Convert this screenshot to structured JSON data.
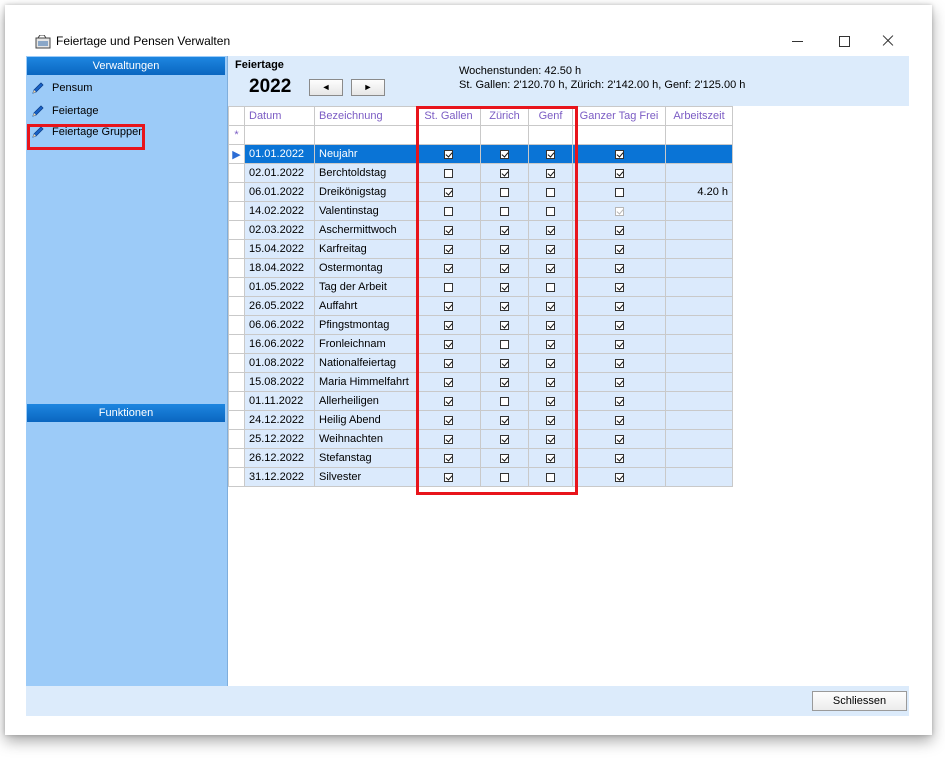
{
  "window": {
    "title": "Feiertage und Pensen Verwalten",
    "close_button": "Schliessen"
  },
  "sidebar": {
    "section1": "Verwaltungen",
    "items": [
      "Pensum",
      "Feiertage",
      "Feiertage Gruppen"
    ],
    "section2": "Funktionen"
  },
  "header": {
    "title": "Feiertage",
    "year": "2022",
    "prev": "◄",
    "next": "►",
    "hours_line": "Wochenstunden: 42.50 h",
    "canton_line": "St. Gallen: 2'120.70 h, Zürich: 2'142.00 h, Genf: 2'125.00 h"
  },
  "grid": {
    "columns": [
      "Datum",
      "Bezeichnung",
      "St. Gallen",
      "Zürich",
      "Genf",
      "Ganzer Tag Frei",
      "Arbeitszeit"
    ],
    "new_row_marker": "*",
    "selected_marker": "▶",
    "rows": [
      {
        "date": "01.01.2022",
        "name": "Neujahr",
        "sg": true,
        "zh": true,
        "ge": true,
        "frei": true,
        "arbeitszeit": ""
      },
      {
        "date": "02.01.2022",
        "name": "Berchtoldstag",
        "sg": false,
        "zh": true,
        "ge": true,
        "frei": true,
        "arbeitszeit": ""
      },
      {
        "date": "06.01.2022",
        "name": "Dreikönigstag",
        "sg": true,
        "zh": false,
        "ge": false,
        "frei": false,
        "arbeitszeit": "4.20 h"
      },
      {
        "date": "14.02.2022",
        "name": "Valentinstag",
        "sg": false,
        "zh": false,
        "ge": false,
        "frei": true,
        "arbeitszeit": "",
        "frei_dim": true
      },
      {
        "date": "02.03.2022",
        "name": "Aschermittwoch",
        "sg": true,
        "zh": true,
        "ge": true,
        "frei": true,
        "arbeitszeit": ""
      },
      {
        "date": "15.04.2022",
        "name": "Karfreitag",
        "sg": true,
        "zh": true,
        "ge": true,
        "frei": true,
        "arbeitszeit": ""
      },
      {
        "date": "18.04.2022",
        "name": "Ostermontag",
        "sg": true,
        "zh": true,
        "ge": true,
        "frei": true,
        "arbeitszeit": ""
      },
      {
        "date": "01.05.2022",
        "name": "Tag der Arbeit",
        "sg": false,
        "zh": true,
        "ge": false,
        "frei": true,
        "arbeitszeit": ""
      },
      {
        "date": "26.05.2022",
        "name": "Auffahrt",
        "sg": true,
        "zh": true,
        "ge": true,
        "frei": true,
        "arbeitszeit": ""
      },
      {
        "date": "06.06.2022",
        "name": "Pfingstmontag",
        "sg": true,
        "zh": true,
        "ge": true,
        "frei": true,
        "arbeitszeit": ""
      },
      {
        "date": "16.06.2022",
        "name": "Fronleichnam",
        "sg": true,
        "zh": false,
        "ge": true,
        "frei": true,
        "arbeitszeit": ""
      },
      {
        "date": "01.08.2022",
        "name": "Nationalfeiertag",
        "sg": true,
        "zh": true,
        "ge": true,
        "frei": true,
        "arbeitszeit": ""
      },
      {
        "date": "15.08.2022",
        "name": "Maria Himmelfahrt",
        "sg": true,
        "zh": true,
        "ge": true,
        "frei": true,
        "arbeitszeit": ""
      },
      {
        "date": "01.11.2022",
        "name": "Allerheiligen",
        "sg": true,
        "zh": false,
        "ge": true,
        "frei": true,
        "arbeitszeit": ""
      },
      {
        "date": "24.12.2022",
        "name": "Heilig Abend",
        "sg": true,
        "zh": true,
        "ge": true,
        "frei": true,
        "arbeitszeit": ""
      },
      {
        "date": "25.12.2022",
        "name": "Weihnachten",
        "sg": true,
        "zh": true,
        "ge": true,
        "frei": true,
        "arbeitszeit": ""
      },
      {
        "date": "26.12.2022",
        "name": "Stefanstag",
        "sg": true,
        "zh": true,
        "ge": true,
        "frei": true,
        "arbeitszeit": ""
      },
      {
        "date": "31.12.2022",
        "name": "Silvester",
        "sg": true,
        "zh": false,
        "ge": false,
        "frei": true,
        "arbeitszeit": ""
      }
    ]
  },
  "colors": {
    "section_header": "#0a66c0",
    "sidebar_bg": "#9ccbf8",
    "selected_row": "#0a74d6",
    "row_bg": "#dbeafc",
    "highlight": "#e8141b"
  }
}
